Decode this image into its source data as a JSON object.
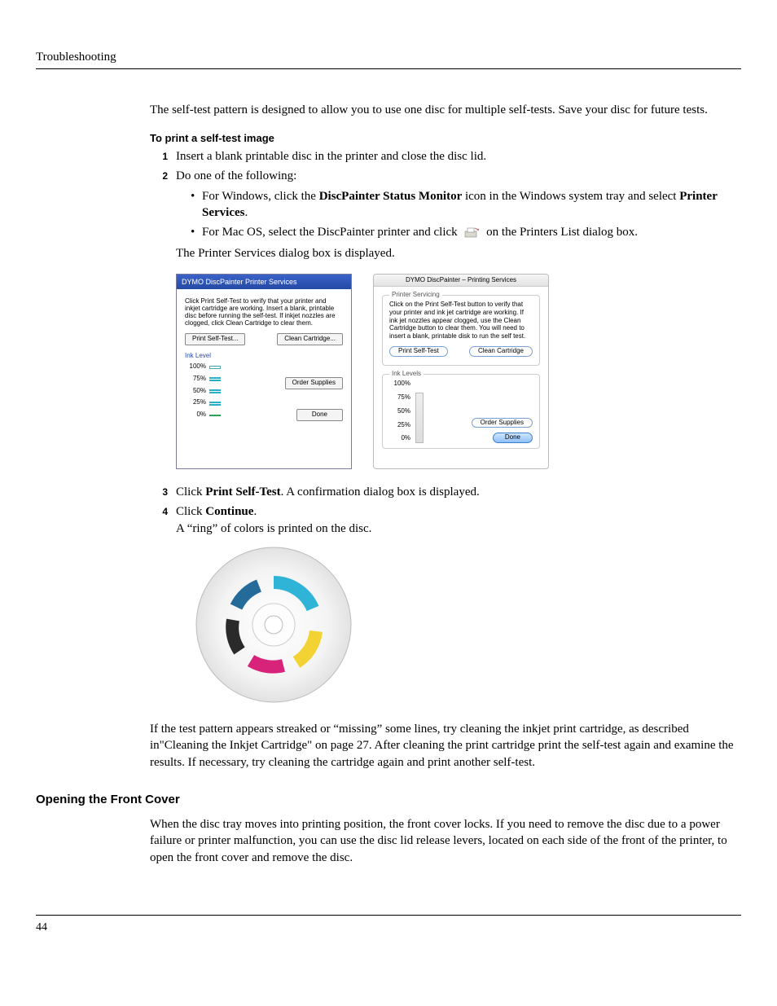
{
  "header": "Troubleshooting",
  "intro": "The self-test pattern is designed to allow you to use one disc for multiple self-tests. Save your disc for future tests.",
  "proc_title": "To print a self-test image",
  "steps": {
    "s1": "Insert a blank printable disc in the printer and close the disc lid.",
    "s2": "Do one of the following:",
    "s2_win_a": "For Windows, click the ",
    "s2_win_b": "DiscPainter Status Monitor",
    "s2_win_c": " icon in the Windows system tray and select ",
    "s2_win_d": "Printer Services",
    "s2_win_e": ".",
    "s2_mac_a": "For Mac OS, select the DiscPainter printer and click ",
    "s2_mac_b": " on the Printers List dialog box.",
    "s2_after": "The Printer Services dialog box is displayed.",
    "s3_a": "Click ",
    "s3_b": "Print Self-Test",
    "s3_c": ". A confirmation dialog box is displayed.",
    "s4_a": "Click ",
    "s4_b": "Continue",
    "s4_c": ".",
    "s4_after": "A “ring” of colors is printed on the disc."
  },
  "win_dialog": {
    "title": "DYMO DiscPainter Printer Services",
    "desc": "Click Print Self-Test to verify that your printer and inkjet cartridge are working. Insert a blank, printable disc before running the self-test. If inkjet nozzles are clogged, click Clean Cartridge to clear them.",
    "btn_selftest": "Print Self-Test...",
    "btn_clean": "Clean Cartridge...",
    "ink_title": "Ink Level",
    "levels": [
      "100%",
      "75%",
      "50%",
      "25%",
      "0%"
    ],
    "btn_order": "Order Supplies",
    "btn_done": "Done"
  },
  "mac_dialog": {
    "title": "DYMO DiscPainter – Printing Services",
    "group1": "Printer Servicing",
    "desc": "Click on the Print Self-Test button to verify that your printer and ink jet cartridge are working. If ink jet nozzles appear clogged, use the Clean Cartridge button to clear them. You will need to insert a blank, printable disk to run the self test.",
    "btn_selftest": "Print Self-Test",
    "btn_clean": "Clean Cartridge",
    "group2": "Ink Levels",
    "levels": [
      "100%",
      "75%",
      "50%",
      "25%",
      "0%"
    ],
    "btn_order": "Order Supplies",
    "btn_done": "Done"
  },
  "after_disc": "If the test pattern appears streaked or “missing” some lines, try cleaning the inkjet print cartridge, as described in\"Cleaning the Inkjet Cartridge\" on page 27. After cleaning the print cartridge print the self-test again and examine the results. If necessary, try cleaning the cartridge again and print another self-test.",
  "section2_title": "Opening the Front Cover",
  "section2_body": "When the disc tray moves into printing position, the front cover locks. If you need to remove the disc due to a power failure or printer malfunction, you can use the disc lid release levers, located on each side of the front of the printer, to open the front cover and remove the disc.",
  "page_number": "44"
}
